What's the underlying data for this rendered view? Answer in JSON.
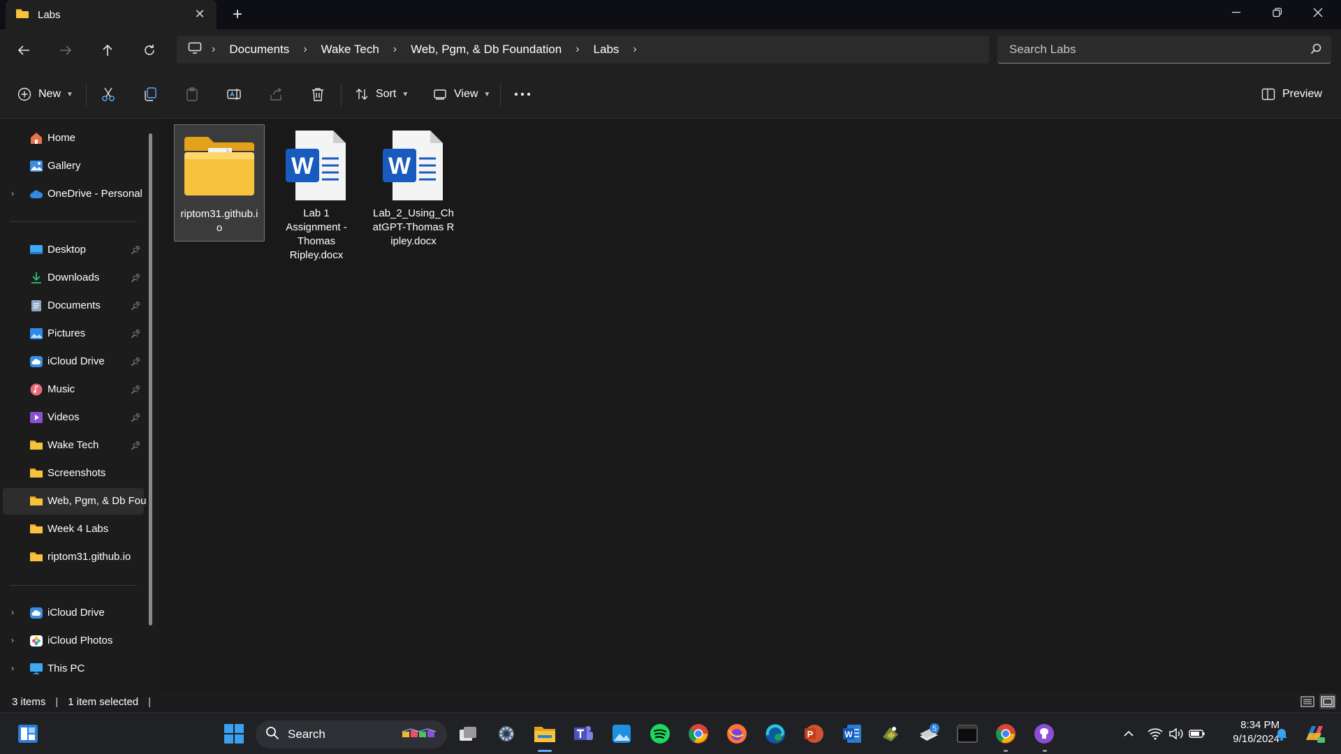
{
  "window": {
    "tab_title": "Labs",
    "controls": {
      "minimize": "minimize",
      "maximize": "restore",
      "close": "close"
    }
  },
  "nav": {
    "breadcrumb": [
      "Documents",
      "Wake Tech",
      "Web, Pgm, & Db Foundation",
      "Labs"
    ],
    "search_placeholder": "Search Labs"
  },
  "commands": {
    "new_label": "New",
    "sort_label": "Sort",
    "view_label": "View",
    "preview_label": "Preview"
  },
  "sidebar": {
    "top": [
      {
        "label": "Home",
        "icon": "home-icon"
      },
      {
        "label": "Gallery",
        "icon": "gallery-icon"
      },
      {
        "label": "OneDrive - Personal",
        "icon": "onedrive-icon"
      }
    ],
    "quick_access": [
      {
        "label": "Desktop",
        "icon": "desktop-icon",
        "pinned": true
      },
      {
        "label": "Downloads",
        "icon": "downloads-icon",
        "pinned": true
      },
      {
        "label": "Documents",
        "icon": "documents-icon",
        "pinned": true
      },
      {
        "label": "Pictures",
        "icon": "pictures-icon",
        "pinned": true
      },
      {
        "label": "iCloud Drive",
        "icon": "icloud-icon",
        "pinned": true
      },
      {
        "label": "Music",
        "icon": "music-icon",
        "pinned": true
      },
      {
        "label": "Videos",
        "icon": "videos-icon",
        "pinned": true
      },
      {
        "label": "Wake Tech",
        "icon": "folder-icon",
        "pinned": true
      },
      {
        "label": "Screenshots",
        "icon": "folder-icon",
        "pinned": false
      },
      {
        "label": "Web, Pgm, & Db Fou",
        "icon": "folder-icon",
        "pinned": false,
        "selected": true
      },
      {
        "label": "Week 4 Labs",
        "icon": "folder-icon",
        "pinned": false
      },
      {
        "label": "riptom31.github.io",
        "icon": "folder-icon",
        "pinned": false
      }
    ],
    "bottom": [
      {
        "label": "iCloud Drive",
        "icon": "icloud-icon"
      },
      {
        "label": "iCloud Photos",
        "icon": "icloud-photos-icon"
      },
      {
        "label": "This PC",
        "icon": "this-pc-icon"
      }
    ]
  },
  "files": [
    {
      "name": "riptom31.github.io",
      "type": "folder",
      "selected": true
    },
    {
      "name": "Lab 1 Assignment - Thomas Ripley.docx",
      "type": "word",
      "selected": false
    },
    {
      "name": "Lab_2_Using_ChatGPT-Thomas Ripley.docx",
      "type": "word",
      "selected": false
    }
  ],
  "status": {
    "item_count": "3 items",
    "selection": "1 item selected"
  },
  "taskbar": {
    "search_label": "Search",
    "time": "8:34 PM",
    "date": "9/16/2024",
    "badge_count": "5"
  },
  "colors": {
    "background": "#191919",
    "panel": "#202020",
    "folder_yellow": "#f8c33c",
    "word_blue": "#185abd",
    "accent": "#5cb0ff"
  }
}
